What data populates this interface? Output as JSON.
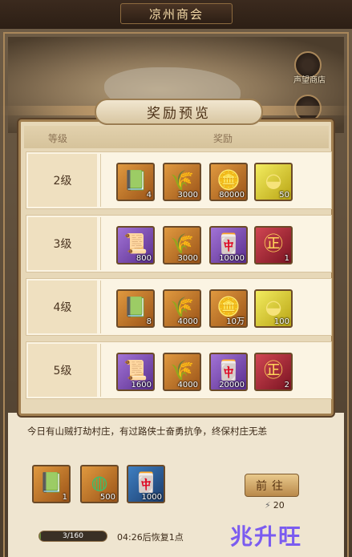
{
  "shop_title": "凉州商会",
  "side_button": {
    "label": "声望商店"
  },
  "modal": {
    "title": "奖励预览",
    "col_level": "等级",
    "col_reward": "奖励",
    "rows": [
      {
        "level": "2级",
        "items": [
          {
            "icon": "green-book-icon",
            "quality": "orange",
            "glyph": "📗",
            "g": "g-book",
            "count": "4"
          },
          {
            "icon": "wheat-icon",
            "quality": "orange",
            "glyph": "🌾",
            "g": "g-wheat",
            "count": "3000"
          },
          {
            "icon": "copper-coin-icon",
            "quality": "orange",
            "glyph": "🪙",
            "g": "g-coin",
            "count": "80000"
          },
          {
            "icon": "gold-ingot-icon",
            "quality": "gold",
            "glyph": "◒",
            "g": "g-ingot",
            "count": "50"
          }
        ]
      },
      {
        "level": "3级",
        "items": [
          {
            "icon": "scroll-icon",
            "quality": "purple",
            "glyph": "📜",
            "g": "g-scroll",
            "count": "800"
          },
          {
            "icon": "wheat-icon",
            "quality": "orange",
            "glyph": "🌾",
            "g": "g-wheat",
            "count": "3000"
          },
          {
            "icon": "jade-token-icon",
            "quality": "purple",
            "glyph": "🀄",
            "g": "g-book",
            "count": "10000"
          },
          {
            "icon": "seal-medal-icon",
            "quality": "red",
            "glyph": "㊣",
            "g": "g-seal",
            "count": "1"
          }
        ]
      },
      {
        "level": "4级",
        "items": [
          {
            "icon": "green-book-icon",
            "quality": "orange",
            "glyph": "📗",
            "g": "g-book",
            "count": "8"
          },
          {
            "icon": "wheat-icon",
            "quality": "orange",
            "glyph": "🌾",
            "g": "g-wheat",
            "count": "4000"
          },
          {
            "icon": "copper-coin-icon",
            "quality": "orange",
            "glyph": "🪙",
            "g": "g-coin",
            "count": "10万"
          },
          {
            "icon": "gold-ingot-icon",
            "quality": "gold",
            "glyph": "◒",
            "g": "g-ingot",
            "count": "100"
          }
        ]
      },
      {
        "level": "5级",
        "items": [
          {
            "icon": "scroll-icon",
            "quality": "purple",
            "glyph": "📜",
            "g": "g-scroll",
            "count": "1600"
          },
          {
            "icon": "wheat-icon",
            "quality": "orange",
            "glyph": "🌾",
            "g": "g-wheat",
            "count": "4000"
          },
          {
            "icon": "jade-token-icon",
            "quality": "purple",
            "glyph": "🀄",
            "g": "g-book",
            "count": "20000"
          },
          {
            "icon": "seal-medal-icon",
            "quality": "red",
            "glyph": "㊣",
            "g": "g-seal",
            "count": "2"
          }
        ]
      }
    ]
  },
  "story_text": "今日有山贼打劫村庄，有过路侠士奋勇抗争，终保村庄无恙",
  "bottom_rewards": [
    {
      "icon": "green-book-icon",
      "quality": "orange",
      "glyph": "📗",
      "g": "g-book",
      "count": "1"
    },
    {
      "icon": "jade-disc-icon",
      "quality": "orange",
      "glyph": "◍",
      "g": "g-book",
      "count": "500"
    },
    {
      "icon": "jade-token-icon",
      "quality": "blue",
      "glyph": "🀄",
      "g": "g-book",
      "count": "1000"
    }
  ],
  "go_button": "前往",
  "go_cost": "20",
  "stamina": {
    "text": "3/160",
    "fraction": 0.019
  },
  "timer_text": "04:26后恢复1点",
  "watermark": "兆升旺"
}
